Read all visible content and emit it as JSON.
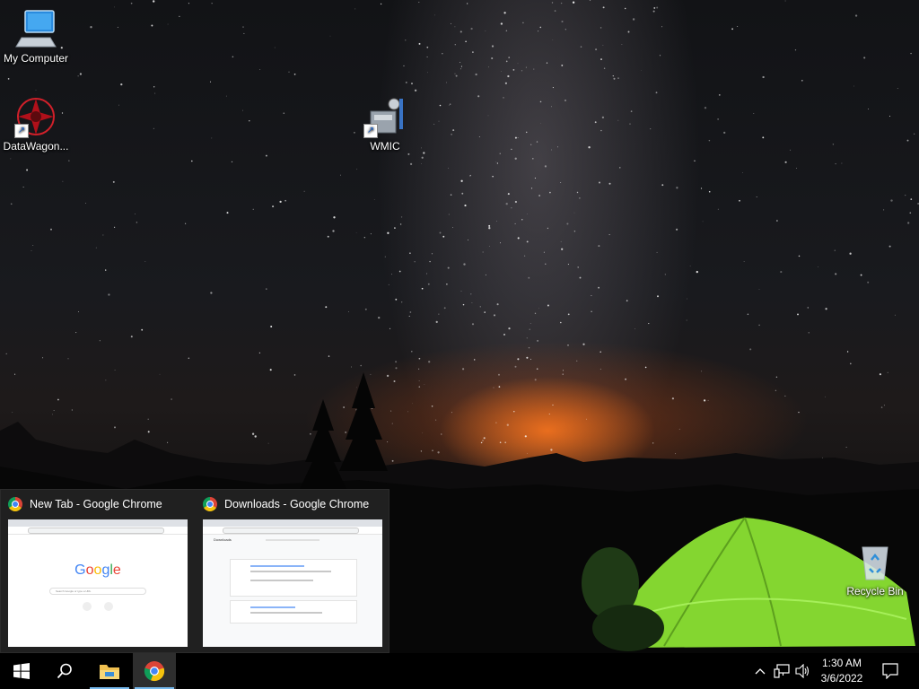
{
  "desktop": {
    "icons": [
      {
        "label": "My Computer",
        "icon": "computer-icon"
      },
      {
        "label": "DataWagon...",
        "icon": "datawagon-icon"
      },
      {
        "label": "WMIC",
        "icon": "wmic-icon"
      },
      {
        "label": "Recycle Bin",
        "icon": "recycle-bin-icon"
      }
    ]
  },
  "thumbnails": [
    {
      "title": "New Tab - Google Chrome",
      "icon": "chrome-icon",
      "preview": {
        "logo": [
          "G",
          "o",
          "o",
          "g",
          "l",
          "e"
        ],
        "search_placeholder": "Search Google or type a URL"
      }
    },
    {
      "title": "Downloads - Google Chrome",
      "icon": "chrome-icon",
      "preview": {
        "page_title": "Downloads"
      }
    }
  ],
  "taskbar": {
    "start_icon": "windows-start-icon",
    "search_icon": "search-icon",
    "pinned": [
      {
        "name": "File Explorer",
        "icon": "folder-icon"
      },
      {
        "name": "Google Chrome",
        "icon": "chrome-icon",
        "active": true
      }
    ],
    "tray": {
      "icons": [
        "chevron-up-icon",
        "network-icon",
        "volume-icon"
      ],
      "time": "1:30 AM",
      "date": "3/6/2022",
      "notification_icon": "notification-icon"
    }
  },
  "colors": {
    "taskbar": "#000000",
    "active_underline": "#76b9ed",
    "tent_green": "#8ee03a"
  }
}
